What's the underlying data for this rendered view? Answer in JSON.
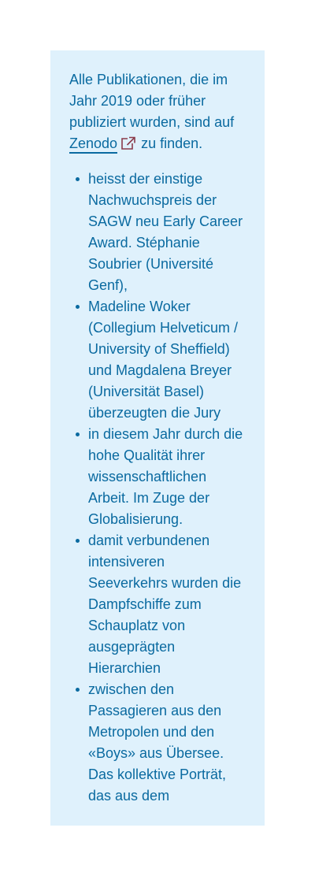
{
  "info_box": {
    "intro_before_link": "Alle Publikationen, die im Jahr 2019 oder früher publiziert wurden, sind auf ",
    "link_label": "Zenodo",
    "link_icon": "external-link-icon",
    "intro_after_link": "zu finden.",
    "colors": {
      "background": "#dff1fc",
      "text": "#0a6aa0",
      "icon": "#8a3a4a"
    }
  },
  "bullets": [
    "heisst der einstige Nachwuchspreis der SAGW neu Early Career Award. Stéphanie Soubrier (Université Genf),",
    "Madeline Woker (Collegium Helveticum / University of Sheffield) und Magdalena Breyer (Universität Basel) überzeugten die Jury",
    "in diesem Jahr durch die hohe Qualität ihrer wissenschaftlichen Arbeit. Im Zuge der Globalisierung.",
    "damit verbundenen intensiveren Seeverkehrs wurden die Dampfschiffe zum Schauplatz von ausgeprägten Hierarchien",
    "zwischen den Passagieren aus den Metropolen und den «Boys» aus Übersee. Das kollektive Porträt, das aus dem"
  ]
}
